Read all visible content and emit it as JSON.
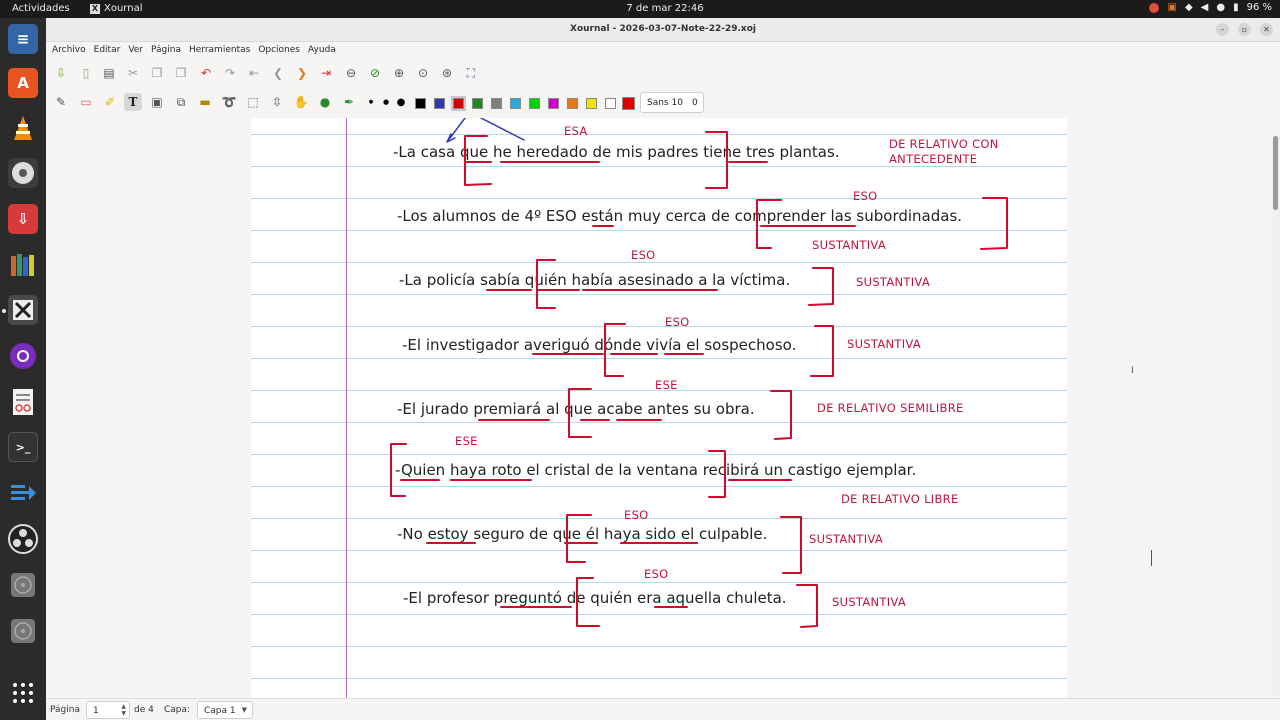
{
  "system_bar": {
    "activities": "Actividades",
    "app_name": "Xournal",
    "clock": "7 de mar  22:46",
    "battery": "96 %"
  },
  "dock": {
    "items": [
      "text-editor-icon",
      "software-center-icon",
      "vlc-icon",
      "media-player-icon",
      "download-icon",
      "library-icon",
      "xournal-icon",
      "podcast-icon",
      "document-viewer-icon",
      "terminal-icon",
      "remote-desktop-icon",
      "obs-icon",
      "disc-icon",
      "disc-icon",
      "show-apps-icon"
    ]
  },
  "window": {
    "title": "Xournal - 2026-03-07-Note-22-29.xoj"
  },
  "menu": {
    "items": [
      "Archivo",
      "Editar",
      "Ver",
      "Página",
      "Herramientas",
      "Opciones",
      "Ayuda"
    ]
  },
  "toolbar": {
    "font_name": "Sans 10",
    "font_size": "0"
  },
  "palette": [
    "#000000",
    "#2e3ab5",
    "#d10000",
    "#1e8a1e",
    "#7f7f7f",
    "#2aa9e0",
    "#00d100",
    "#d100d1",
    "#e67817",
    "#f2e600",
    "#ffffff"
  ],
  "current_color": "#e00000",
  "note": {
    "sentences": [
      "-La casa que he heredado de mis padres tiene tres plantas.",
      "-Los alumnos de 4º ESO están muy cerca de comprender las subordinadas.",
      "-La policía sabía quién había asesinado a la víctima.",
      "-El investigador averiguó dónde vivía el sospechoso.",
      "-El jurado premiará al que acabe antes su obra.",
      "-Quien haya roto el cristal de la ventana recibirá un castigo ejemplar.",
      "-No estoy seguro de que él haya sido el culpable.",
      "-El profesor preguntó de quién era aquella chuleta."
    ],
    "annotations": {
      "esa": "ESA",
      "relativo_antecedente_1": "DE RELATIVO CON",
      "relativo_antecedente_2": "ANTECEDENTE",
      "eso_2": "ESO",
      "sustantiva_2": "SUSTANTIVA",
      "eso_3": "ESO",
      "sustantiva_3": "SUSTANTIVA",
      "eso_4": "ESO",
      "sustantiva_4": "SUSTANTIVA",
      "ese_5": "ESE",
      "semilibre": "DE RELATIVO SEMILIBRE",
      "ese_6": "ESE",
      "libre": "DE RELATIVO LIBRE",
      "eso_7": "ESO",
      "sustantiva_7": "SUSTANTIVA",
      "eso_8": "ESO",
      "sustantiva_8": "SUSTANTIVA"
    }
  },
  "status": {
    "page_label": "Página",
    "page_value": "1",
    "page_of": "de 4",
    "layer_label": "Capa:",
    "layer_value": "Capa 1"
  }
}
